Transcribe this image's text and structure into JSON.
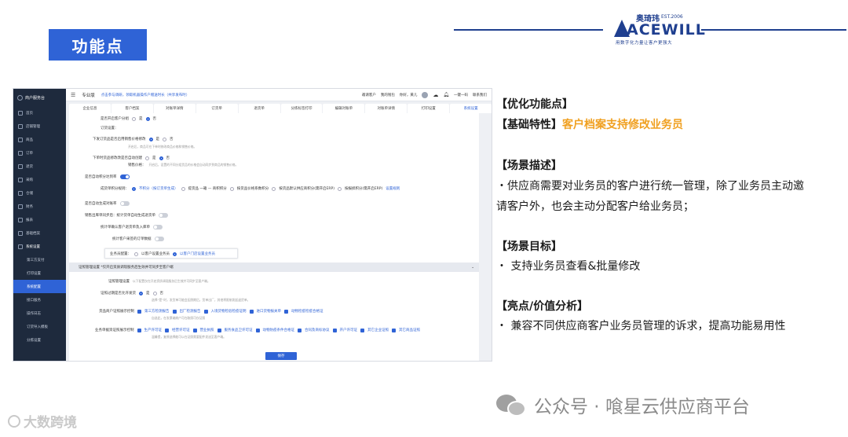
{
  "slide_title": "功能点",
  "logo": {
    "brand_cn": "奥琦玮",
    "est": "EST.2006",
    "brand_en": "ACEWILL",
    "slogan": "用数字化力量让客户更强大"
  },
  "screenshot": {
    "sidebar": {
      "brand": "商户服务台",
      "items": [
        {
          "label": "首页"
        },
        {
          "label": "店铺管理"
        },
        {
          "label": "商品"
        },
        {
          "label": "订单"
        },
        {
          "label": "退货"
        },
        {
          "label": "采购"
        },
        {
          "label": "仓储"
        },
        {
          "label": "财务"
        },
        {
          "label": "报表"
        },
        {
          "label": "基础档案"
        },
        {
          "label": "系统设置"
        }
      ],
      "sub_items": [
        {
          "label": "第三方支付"
        },
        {
          "label": "打印设置"
        },
        {
          "label": "系统配置"
        },
        {
          "label": "接口服务"
        },
        {
          "label": "操作日志"
        },
        {
          "label": "订货导入模板"
        },
        {
          "label": "分拣设置"
        }
      ]
    },
    "topbar": {
      "edition": "专业版",
      "notice": "点击参与调研，领取机器操作户赠送时长（共享发布时）",
      "right_items": [
        "邀请客户",
        "我的钱包",
        "你好，黄儿",
        "帮助",
        "一键一码",
        "联系我们"
      ]
    },
    "tabs": [
      "企业信息",
      "客户档案",
      "对账单详情",
      "订货单",
      "退货单",
      "分拣标签打印",
      "编辑对账单",
      "对账单详情",
      "打印设置",
      "系统设置"
    ],
    "settings": {
      "show_customer_group": "是否开启客户分组",
      "yes": "是",
      "no": "否",
      "ordering_settings": "订货设置：",
      "allow_price_modify": "下发订货品是否启用销售价格修改",
      "allow_price_hint": "开启后，商品可在下单时修改商品价格和销售价格。",
      "allow_sku_modify": "下单时货品修改改是否自动创建",
      "sales_price_label": "销售价格：",
      "sales_price_hint": "开启后，设置的不同分组货品的价格会自动同步到商品的销售价格。",
      "auto_sort_points": "是否自动积分达到率",
      "points_rule_label": "成货单积分规则：",
      "points_options": [
        "不积分（按订货单生成）",
        "提货品 一箱 — 商积积分",
        "按货品价格系数积分",
        "按货品默认供应商积分(需开启ERP)",
        "按报损积分(需开启ERP)"
      ],
      "points_link": "设置规则",
      "auto_gen_points": "是否自动生成对账率",
      "sales_order_receipt": "销售出库单同步后：统计货单自动生成退货单",
      "auto_confirm_receipt": "统计单确认客户退货单及入库单",
      "auto_confirm_order": "统计客户采签的订单数据",
      "salesman_assign_label": "业务员配置：",
      "salesman_options": [
        "以客户设置业务员",
        "以客户门店设置业务员"
      ],
      "supplier_section": "证照管理设置 *仅开启资质调现服务后生效并可同步至客户端",
      "supplier_manage": "证照管理设置",
      "supplier_manage_hint": "以下配置仅在开启资质调现服务后生效并可同步至客户端。",
      "cert_expire_label": "证照过期是否允许发货",
      "cert_expire_hint": "选择“是”时，发货单可能会因到期后，货单出厂，其他将限制发起退货单。",
      "goods_cert_label": "货品商户证照展示控制",
      "goods_cert_options": [
        "第三方检测报告",
        "出厂检测报告",
        "入境货物检验检疫证明",
        "进口货物报关单",
        "动物检疫检疫合格证"
      ],
      "goods_cert_hint": "自选此，在发票端商户可在取照可仅证照",
      "business_cert_label": "业务单据资证照展示控制",
      "business_cert_options": [
        "生产许可证",
        "经营许可证",
        "营业执照",
        "服务食品卫许可证",
        "动物防疫条件合格证",
        "合同及商标协议",
        "开户许可证",
        "其它企业证照",
        "其它商品证照"
      ],
      "business_cert_hint": "温馨提，复原选择能可以在证照需要配件发送至客户端。",
      "save": "保存"
    }
  },
  "content": {
    "optimize": "【优化功能点】",
    "basic_label": "【基础特性】",
    "basic_value": "客户档案支持修改业务员",
    "scene_desc_title": "【场景描述】",
    "scene_desc_line1": "・供应商需要对业务员的客户进行统一管理，除了业务员主动邀",
    "scene_desc_line2": "请客户外，也会主动分配客户给业务员；",
    "scene_goal_title": "【场景目标】",
    "scene_goal_text": "・ 支持业务员查看&批量修改",
    "value_title": "【亮点/价值分析】",
    "value_text": "・ 兼容不同供应商客户业务员管理的诉求，提高功能易用性"
  },
  "watermarks": {
    "wechat": "公众号 · 喰星云供应商平台",
    "left": "大数跨境"
  },
  "colors": {
    "primary": "#2f63d6",
    "navy": "#1f3f8f",
    "orange": "#f0a020",
    "sidebar": "#1e2a3d"
  }
}
